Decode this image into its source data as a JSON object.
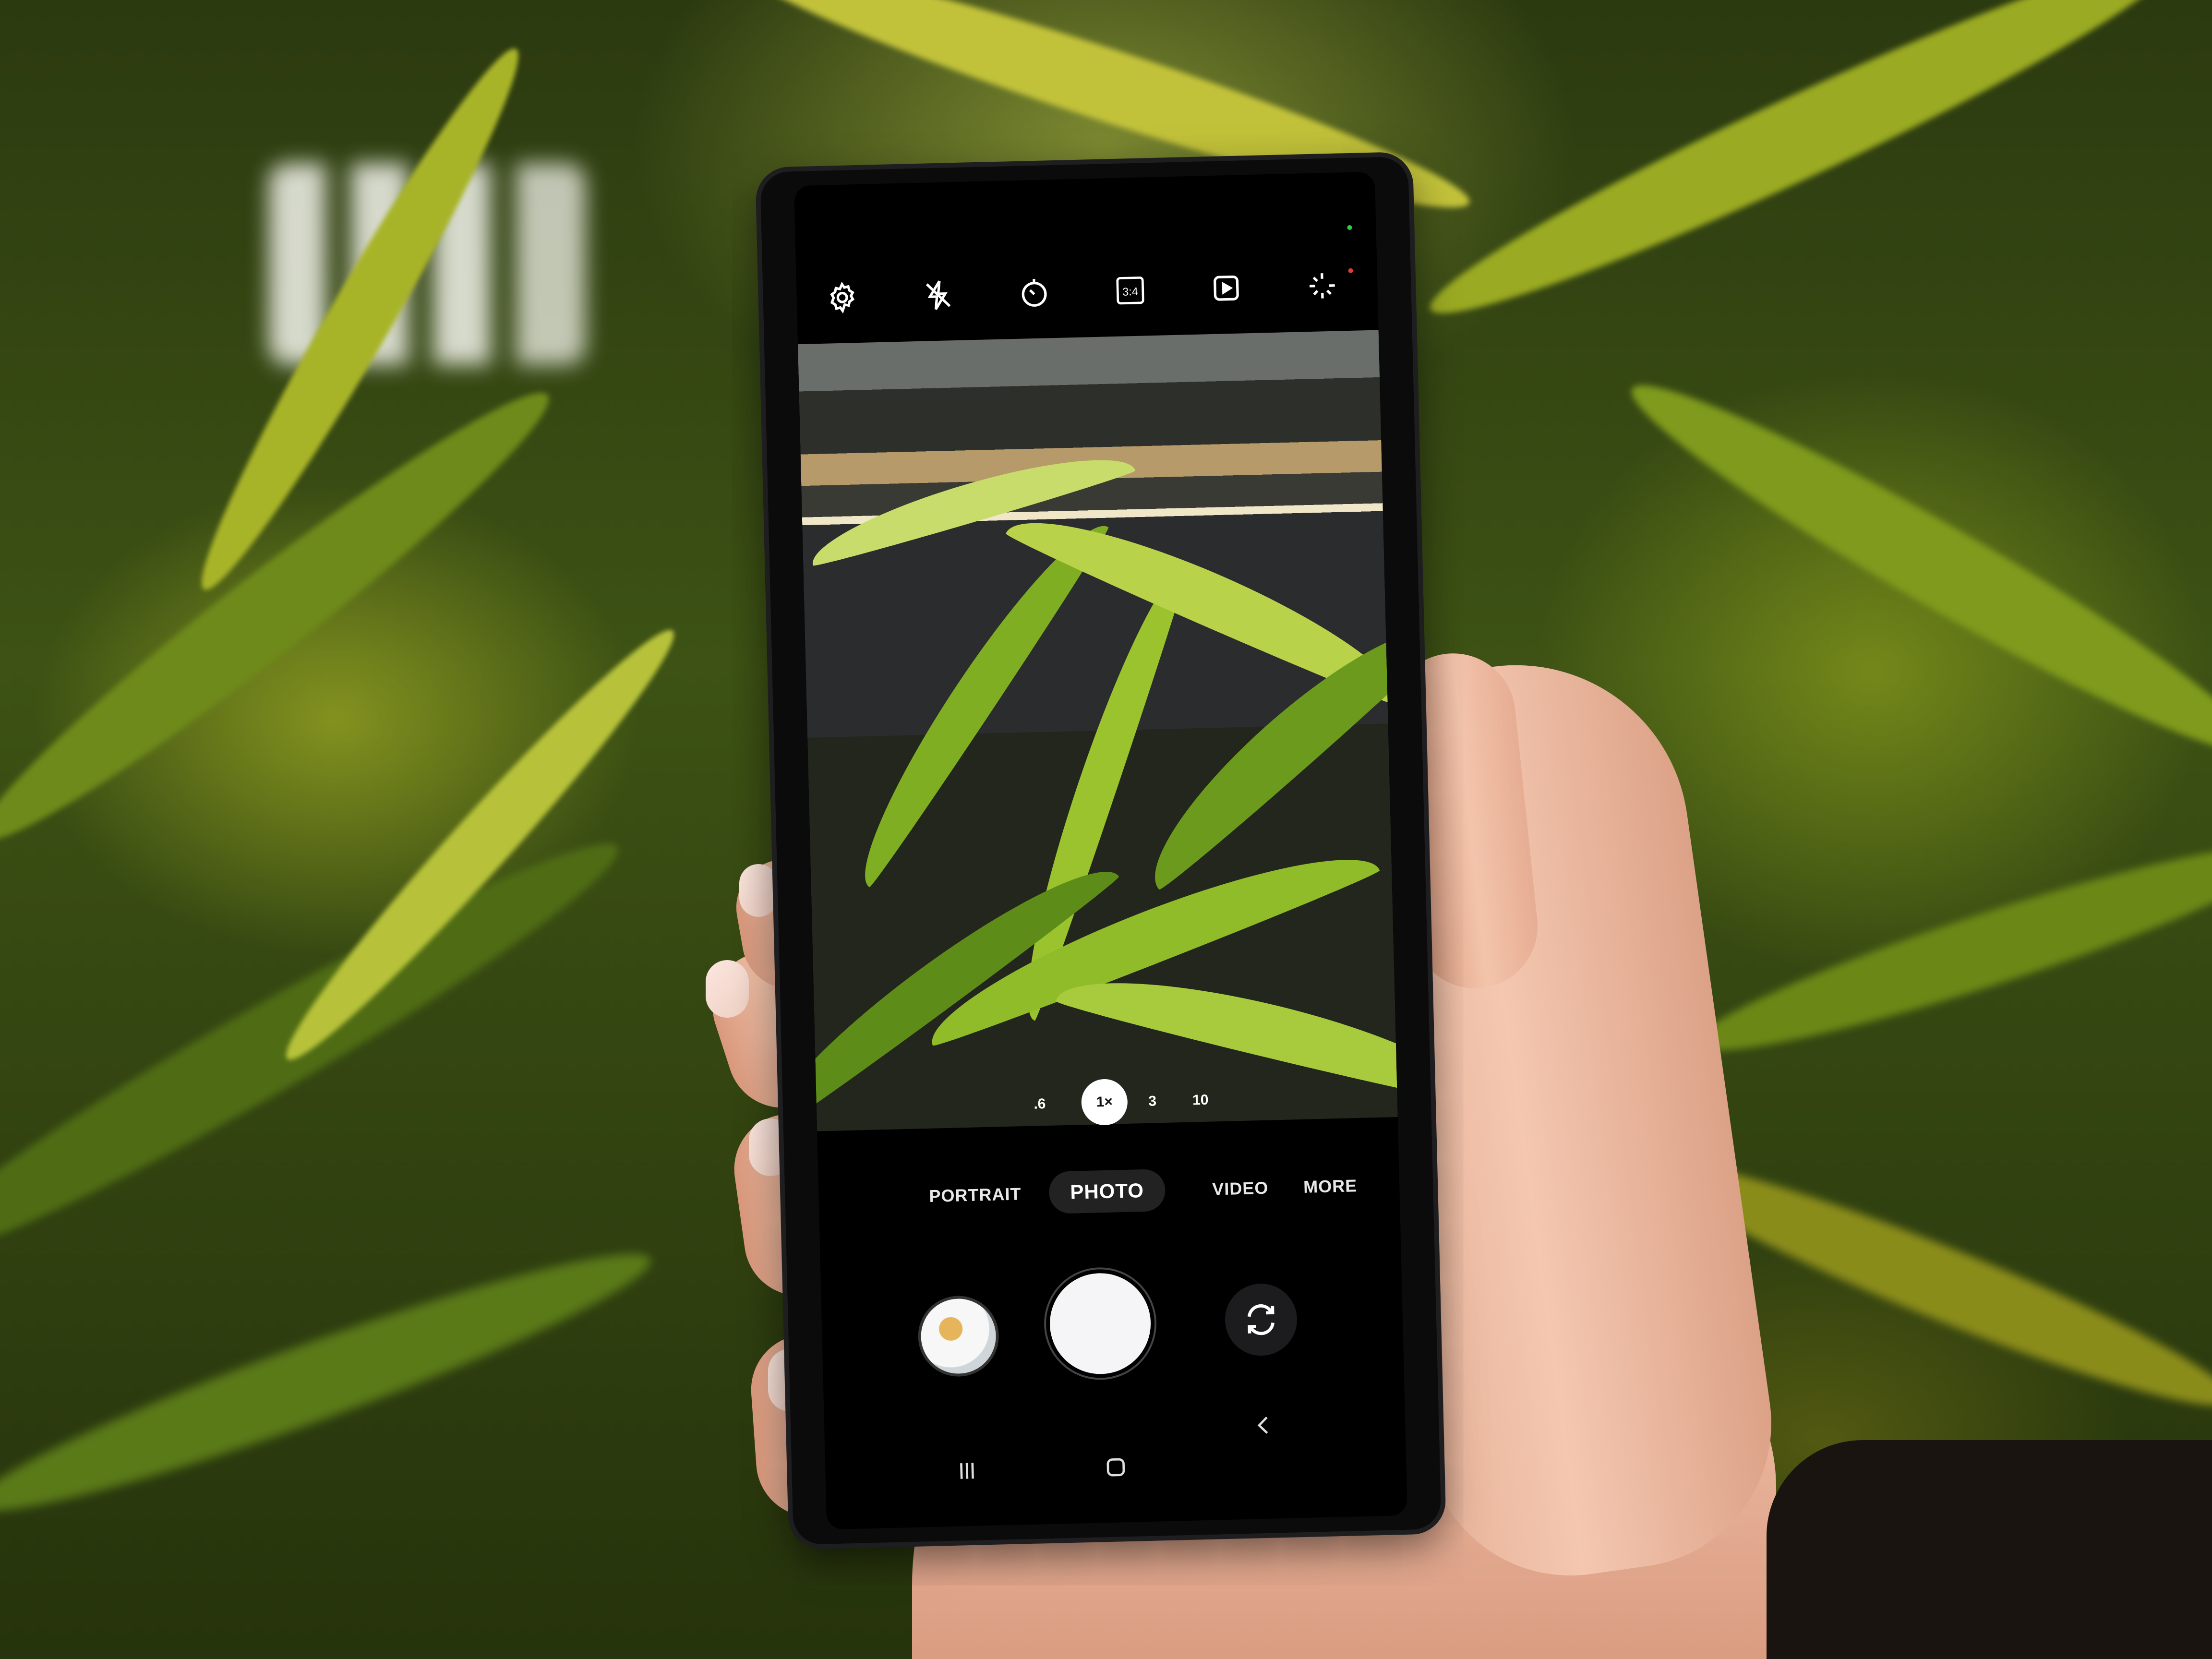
{
  "camera_app": {
    "toolbar": {
      "icons": [
        "settings-icon",
        "flash-off-icon",
        "timer-icon",
        "aspect-ratio-icon",
        "motion-photo-icon",
        "filters-icon"
      ],
      "aspect_ratio_label": "3:4"
    },
    "zoom_levels": [
      {
        "label": ".6",
        "active": false
      },
      {
        "label": "1×",
        "active": true
      },
      {
        "label": "3",
        "active": false
      },
      {
        "label": "10",
        "active": false
      }
    ],
    "modes": [
      {
        "label": "PORTRAIT",
        "active": false
      },
      {
        "label": "PHOTO",
        "active": true
      },
      {
        "label": "VIDEO",
        "active": false
      },
      {
        "label": "MORE",
        "active": false
      }
    ],
    "controls": {
      "gallery": "gallery-thumbnail",
      "shutter": "shutter-button",
      "switch_camera": "switch-camera-icon"
    },
    "nav": [
      "recents-icon",
      "home-icon",
      "back-icon"
    ],
    "colors": {
      "accent": "#ffffff",
      "background": "#000000",
      "status_green": "#2ecc40",
      "status_red": "#e53935"
    }
  }
}
